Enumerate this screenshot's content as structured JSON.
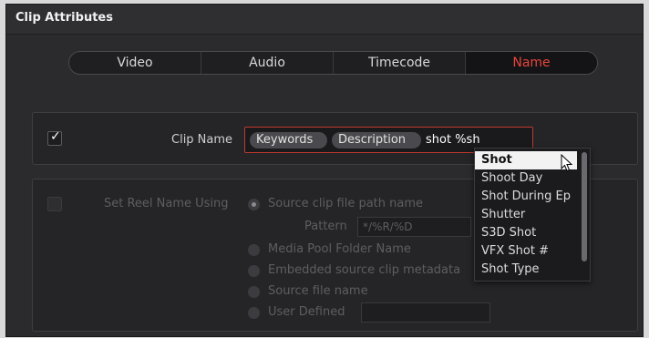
{
  "window": {
    "title": "Clip Attributes"
  },
  "tabs": [
    {
      "label": "Video",
      "active": false
    },
    {
      "label": "Audio",
      "active": false
    },
    {
      "label": "Timecode",
      "active": false
    },
    {
      "label": "Name",
      "active": true
    }
  ],
  "clip_name": {
    "checked": true,
    "label": "Clip Name",
    "chips": [
      "Keywords",
      "Description"
    ],
    "typed_text": "shot %sh"
  },
  "reel": {
    "checked": false,
    "label": "Set Reel Name Using",
    "options": [
      "Source clip file path name",
      "Media Pool Folder Name",
      "Embedded source clip metadata",
      "Source file name",
      "User Defined"
    ],
    "selected_index": 0,
    "pattern_label": "Pattern",
    "pattern_value": "*/%R/%D"
  },
  "dropdown": {
    "items": [
      "Shot",
      "Shoot Day",
      "Shot During Ep",
      "Shutter",
      "S3D Shot",
      "VFX Shot #",
      "Shot Type"
    ],
    "highlighted_index": 0
  },
  "colors": {
    "accent": "#e8453c",
    "field_border": "#c23a2f",
    "panel_bg": "#252528"
  }
}
